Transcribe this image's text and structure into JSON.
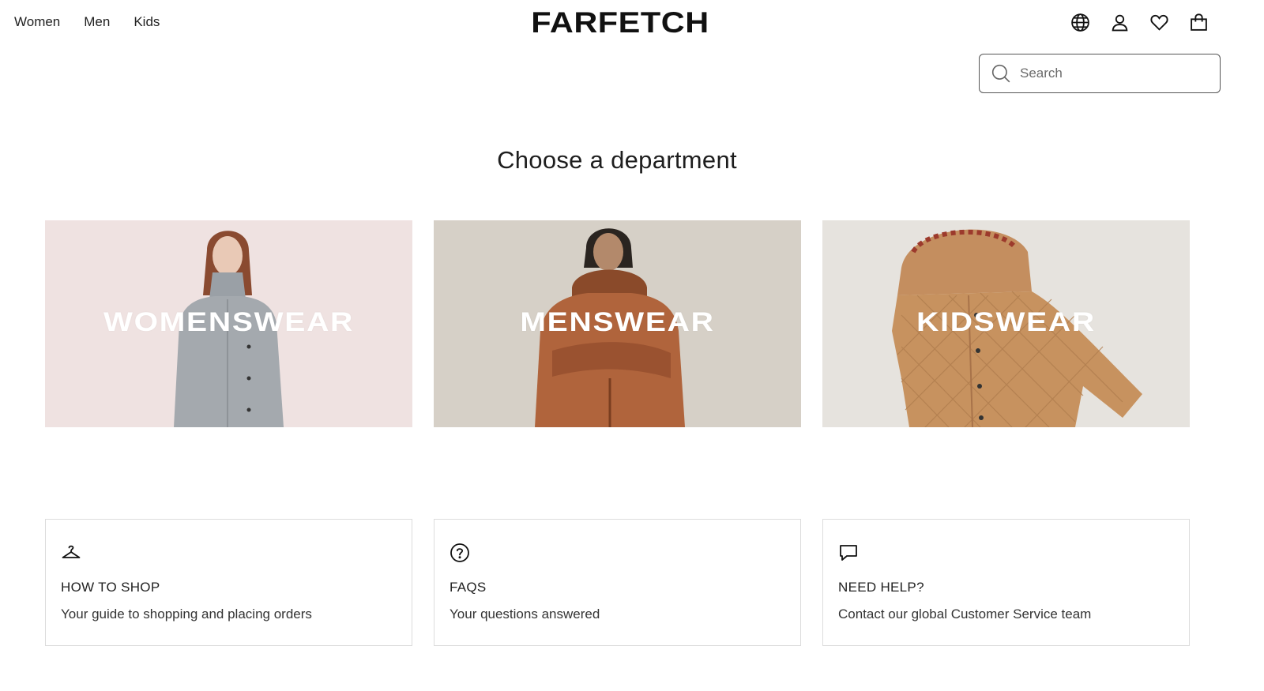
{
  "nav": {
    "items": [
      {
        "label": "Women"
      },
      {
        "label": "Men"
      },
      {
        "label": "Kids"
      }
    ]
  },
  "brand": {
    "logo_text": "FARFETCH"
  },
  "header_icons": [
    "globe-icon",
    "account-icon",
    "heart-icon",
    "bag-icon"
  ],
  "search": {
    "placeholder": "Search",
    "value": ""
  },
  "main": {
    "title": "Choose a department"
  },
  "departments": [
    {
      "label": "WOMENSWEAR",
      "bg": "#efe3e2"
    },
    {
      "label": "MENSWEAR",
      "bg": "#d8d2c9"
    },
    {
      "label": "KIDSWEAR",
      "bg": "#e6e3de"
    }
  ],
  "help_cards": [
    {
      "icon": "hanger-icon",
      "title": "HOW TO SHOP",
      "description": "Your guide to shopping and placing orders"
    },
    {
      "icon": "question-circle-icon",
      "title": "FAQS",
      "description": "Your questions answered"
    },
    {
      "icon": "chat-bubble-icon",
      "title": "NEED HELP?",
      "description": "Contact our global Customer Service team"
    }
  ],
  "colors": {
    "text": "#222222",
    "border": "#dcdcdc",
    "background": "#ffffff"
  }
}
